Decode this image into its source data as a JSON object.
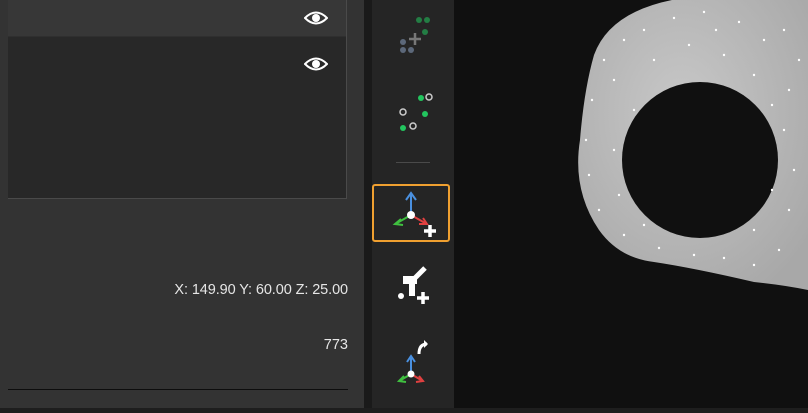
{
  "layers": [
    {
      "icon": "eye-icon",
      "visible": true
    },
    {
      "icon": "eye-icon",
      "visible": true
    }
  ],
  "status": {
    "coordinates": "X: 149.90 Y: 60.00 Z: 25.00",
    "point_count": "773"
  },
  "toolbar": {
    "tools": [
      {
        "icon": "add-points-icon"
      },
      {
        "icon": "select-points-icon"
      },
      {
        "icon": "add-coordinate-frame-icon",
        "active": true
      },
      {
        "icon": "add-tool-pose-icon"
      },
      {
        "icon": "rotate-frame-icon"
      }
    ]
  },
  "colors": {
    "accent": "#f0a030",
    "point_green": "#22c55e",
    "axis_x": "#e04040",
    "axis_y": "#40c040",
    "axis_z": "#4a90e0"
  }
}
